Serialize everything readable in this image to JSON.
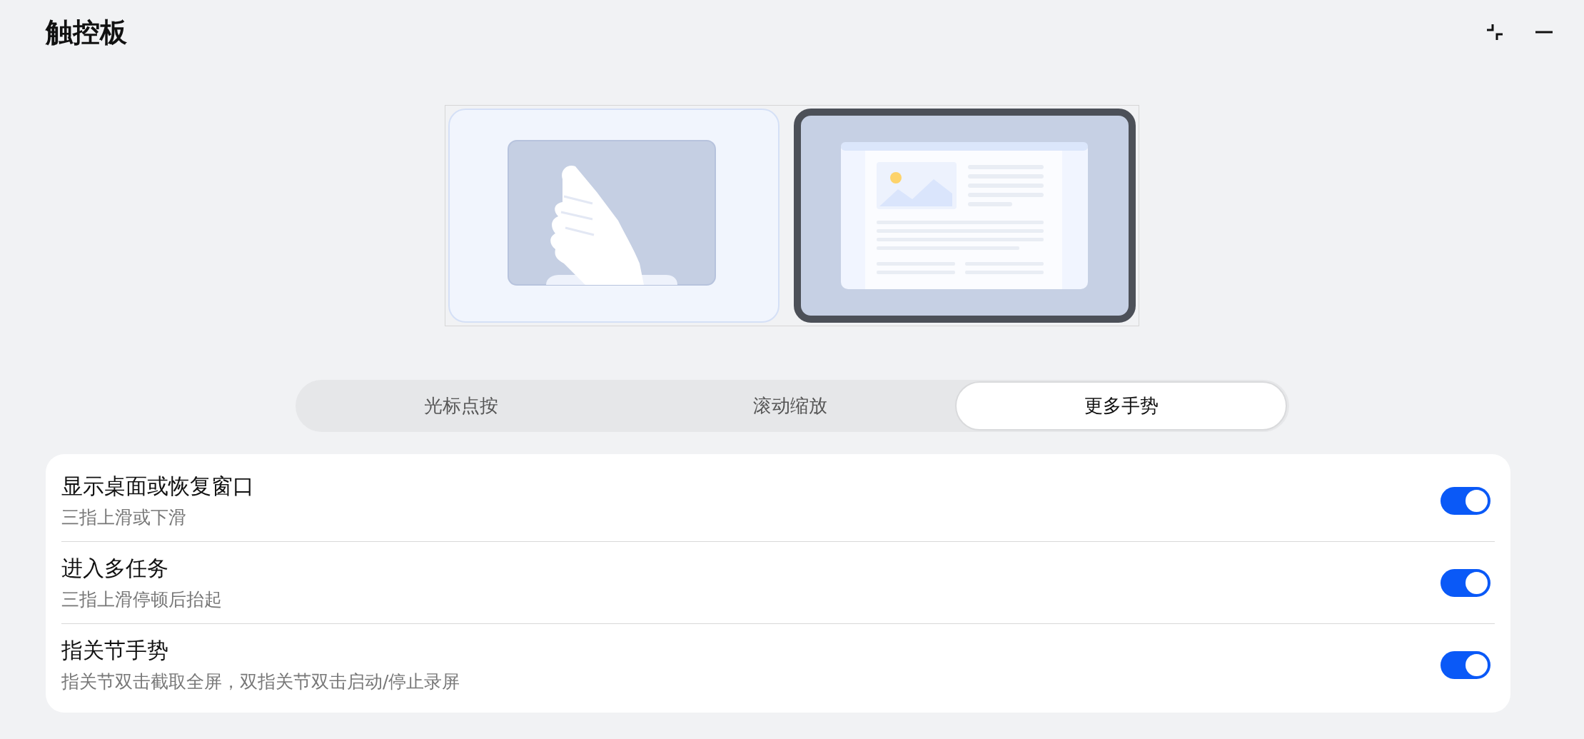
{
  "window": {
    "title": "触控板"
  },
  "previews": [
    {
      "kind": "hand",
      "selected": false
    },
    {
      "kind": "window",
      "selected": true
    }
  ],
  "tabs": [
    {
      "label": "光标点按",
      "selected": false
    },
    {
      "label": "滚动缩放",
      "selected": false
    },
    {
      "label": "更多手势",
      "selected": true
    }
  ],
  "settings": [
    {
      "title": "显示桌面或恢复窗口",
      "description": "三指上滑或下滑",
      "on": true
    },
    {
      "title": "进入多任务",
      "description": "三指上滑停顿后抬起",
      "on": true
    },
    {
      "title": "指关节手势",
      "description": "指关节双击截取全屏，双指关节双击启动/停止录屏",
      "on": true
    }
  ]
}
